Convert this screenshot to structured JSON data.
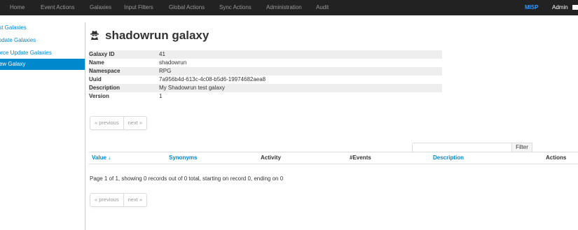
{
  "topbar": {
    "left_items": [
      "Home",
      "Event Actions",
      "Galaxies",
      "Input Filters",
      "Global Actions",
      "Sync Actions",
      "Administration",
      "Audit"
    ],
    "brand": "MISP",
    "user": "Admin"
  },
  "sidebar": {
    "items": [
      {
        "label": "List Galaxies",
        "active": false
      },
      {
        "label": "Update Galaxies",
        "active": false
      },
      {
        "label": "Force Update Galaxies",
        "active": false
      },
      {
        "label": "View Galaxy",
        "active": true
      }
    ]
  },
  "page": {
    "title": "shadowrun galaxy",
    "icon": "user-secret-icon"
  },
  "details": [
    {
      "key": "Galaxy ID",
      "value": "41"
    },
    {
      "key": "Name",
      "value": "shadowrun"
    },
    {
      "key": "Namespace",
      "value": "RPG"
    },
    {
      "key": "Uuid",
      "value": "7a956b4d-613c-4c08-b5d6-19974682aea8"
    },
    {
      "key": "Description",
      "value": "My Shadowrun test galaxy"
    },
    {
      "key": "Version",
      "value": "1"
    }
  ],
  "pagination": {
    "previous": "« previous",
    "next": "next »"
  },
  "filter": {
    "placeholder": "",
    "button": "Filter"
  },
  "table": {
    "columns": [
      {
        "label": "Value ↓",
        "link": true
      },
      {
        "label": "Synonyms",
        "link": true
      },
      {
        "label": "Activity",
        "link": false
      },
      {
        "label": "#Events",
        "link": false
      },
      {
        "label": "Description",
        "link": true
      },
      {
        "label": "Actions",
        "link": false
      }
    ]
  },
  "records_info": "Page 1 of 1, showing 0 records out of 0 total, starting on record 0, ending on 0",
  "colors": {
    "topbar": "#222222",
    "link": "#0088cc",
    "brand": "#3399ff"
  }
}
